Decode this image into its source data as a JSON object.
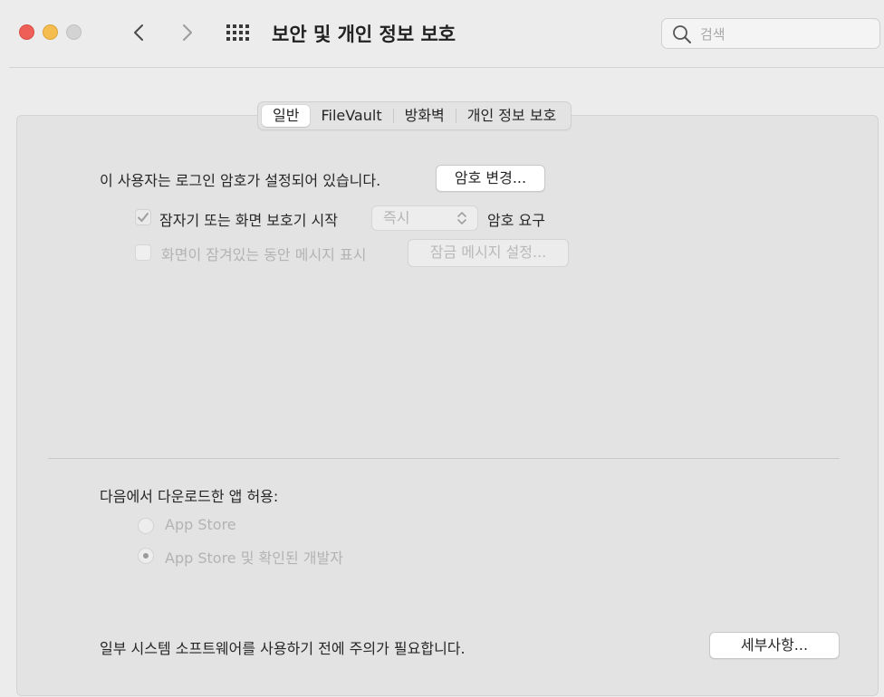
{
  "window": {
    "title": "보안 및 개인 정보 보호",
    "search_placeholder": "검색"
  },
  "tabs": [
    {
      "label": "일반",
      "active": true
    },
    {
      "label": "FileVault",
      "active": false
    },
    {
      "label": "방화벽",
      "active": false
    },
    {
      "label": "개인 정보 보호",
      "active": false
    }
  ],
  "general": {
    "password_text": "이 사용자는 로그인 암호가 설정되어 있습니다.",
    "change_password_button": "암호 변경...",
    "require_password": {
      "checked": true,
      "label": "잠자기 또는 화면 보호기 시작",
      "select_value": "즉시",
      "suffix": "암호 요구"
    },
    "show_message": {
      "checked": false,
      "label": "화면이 잠겨있는 동안 메시지 표시",
      "button": "잠금 메시지 설정..."
    },
    "allow_apps": {
      "heading": "다음에서 다운로드한 앱 허용:",
      "options": [
        {
          "label": "App Store",
          "selected": false
        },
        {
          "label": "App Store 및 확인된 개발자",
          "selected": true
        }
      ]
    },
    "notice": {
      "text": "일부 시스템 소프트웨어를 사용하기 전에 주의가 필요합니다.",
      "button": "세부사항..."
    }
  }
}
